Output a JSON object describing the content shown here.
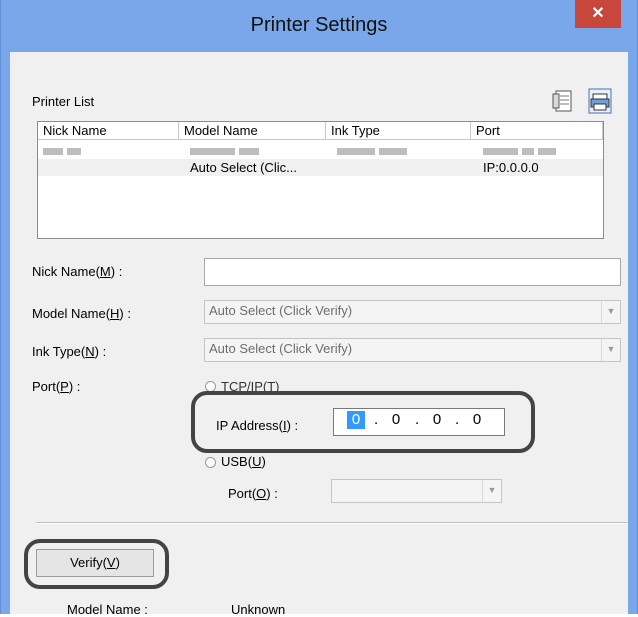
{
  "window": {
    "title": "Printer Settings",
    "close_glyph": "✕"
  },
  "printer_list": {
    "label": "Printer List",
    "columns": [
      "Nick Name",
      "Model Name",
      "Ink Type",
      "Port"
    ],
    "rows": [
      [
        "",
        "",
        "",
        ""
      ],
      [
        "",
        "Auto Select (Clic...",
        "",
        "IP:0.0.0.0"
      ]
    ],
    "icons": [
      "document-settings-icon",
      "printer-search-icon"
    ]
  },
  "form": {
    "nick_name_label": "Nick Name(M) :",
    "nick_name_value": "",
    "model_name_label": "Model Name(H) :",
    "model_name_value": "Auto Select (Click Verify)",
    "ink_type_label": "Ink Type(N) :",
    "ink_type_value": "Auto Select (Click Verify)",
    "port_label": "Port(P) :",
    "tcpip_label": "TCP/IP(T)",
    "ip_address_label": "IP Address(I) :",
    "ip_octets": [
      "0",
      "0",
      "0",
      "0"
    ],
    "usb_label": "USB(U)",
    "usb_port_label": "Port(O) :",
    "usb_port_value": ""
  },
  "verify": {
    "button_label": "Verify(V)",
    "model_name_label": "Model Name :",
    "model_name_value": "Unknown"
  }
}
